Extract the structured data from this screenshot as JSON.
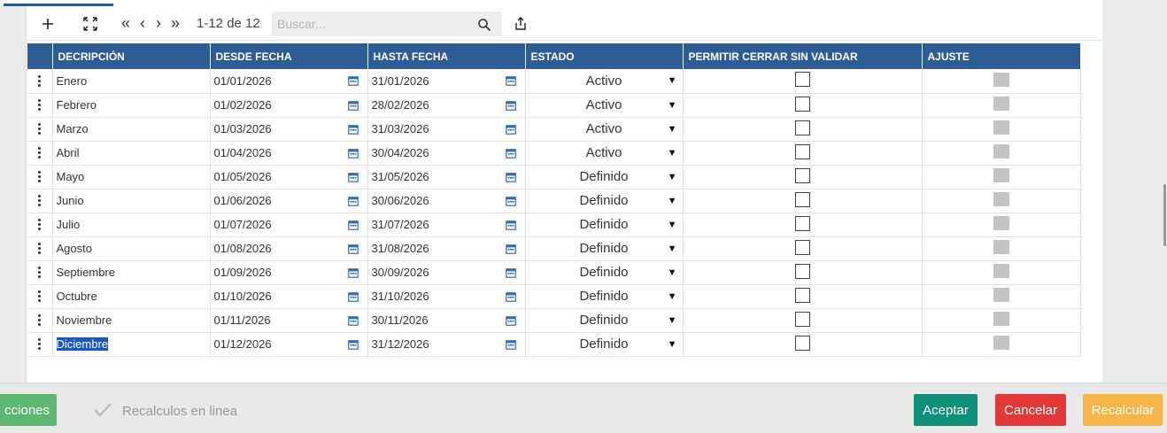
{
  "toolbar": {
    "add_icon": "plus-icon",
    "expand_icon": "expand-icon",
    "first_icon": "«",
    "prev_icon": "‹",
    "next_icon": "›",
    "last_icon": "»",
    "page_count": "1-12 de 12",
    "search_placeholder": "Buscar...",
    "share_icon": "share-icon"
  },
  "table": {
    "headers": [
      "DECRIPCIÓN",
      "DESDE FECHA",
      "HASTA FECHA",
      "ESTADO",
      "PERMITIR CERRAR SIN VALIDAR",
      "AJUSTE"
    ],
    "rows": [
      {
        "descripcion": "Enero",
        "desde": "01/01/2026",
        "hasta": "31/01/2026",
        "estado": "Activo",
        "permitir": false
      },
      {
        "descripcion": "Febrero",
        "desde": "01/02/2026",
        "hasta": "28/02/2026",
        "estado": "Activo",
        "permitir": false
      },
      {
        "descripcion": "Marzo",
        "desde": "01/03/2026",
        "hasta": "31/03/2026",
        "estado": "Activo",
        "permitir": false
      },
      {
        "descripcion": "Abril",
        "desde": "01/04/2026",
        "hasta": "30/04/2026",
        "estado": "Activo",
        "permitir": false
      },
      {
        "descripcion": "Mayo",
        "desde": "01/05/2026",
        "hasta": "31/05/2026",
        "estado": "Definido",
        "permitir": false
      },
      {
        "descripcion": "Junio",
        "desde": "01/06/2026",
        "hasta": "30/06/2026",
        "estado": "Definido",
        "permitir": false
      },
      {
        "descripcion": "Julio",
        "desde": "01/07/2026",
        "hasta": "31/07/2026",
        "estado": "Definido",
        "permitir": false
      },
      {
        "descripcion": "Agosto",
        "desde": "01/08/2026",
        "hasta": "31/08/2026",
        "estado": "Definido",
        "permitir": false
      },
      {
        "descripcion": "Septiembre",
        "desde": "01/09/2026",
        "hasta": "30/09/2026",
        "estado": "Definido",
        "permitir": false
      },
      {
        "descripcion": "Octubre",
        "desde": "01/10/2026",
        "hasta": "31/10/2026",
        "estado": "Definido",
        "permitir": false
      },
      {
        "descripcion": "Noviembre",
        "desde": "01/11/2026",
        "hasta": "30/11/2026",
        "estado": "Definido",
        "permitir": false
      },
      {
        "descripcion": "Diciembre",
        "desde": "01/12/2026",
        "hasta": "31/12/2026",
        "estado": "Definido",
        "permitir": false
      }
    ],
    "selected_row_text": "Diciembre"
  },
  "footer": {
    "acciones_label": "cciones",
    "recalc_label": "Recalculos en linea",
    "aceptar_label": "Aceptar",
    "cancelar_label": "Cancelar",
    "recalcular_label": "Recalcular"
  },
  "colors": {
    "header_bg": "#2d5d94",
    "aceptar": "#0e8f78",
    "cancelar": "#e43838",
    "recalcular": "#f7b547",
    "acciones": "#5cb870",
    "calendar_icon": "#2d6cb5"
  }
}
